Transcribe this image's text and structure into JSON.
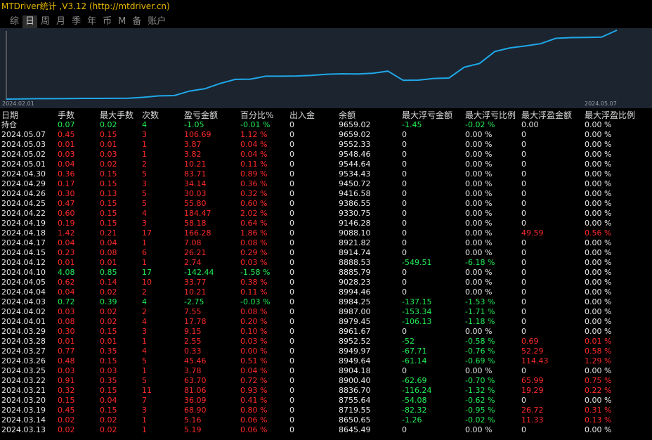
{
  "title": "MTDriver统计 ,V3.12 (http://mtdriver.cn)",
  "tabs": [
    "综",
    "日",
    "周",
    "月",
    "季",
    "年",
    "币",
    "M",
    "备",
    "账户"
  ],
  "active_tab": "日",
  "chart": {
    "start_label": "2024.02.01",
    "end_label": "2024.05.07",
    "line_color": "#1fa8e8",
    "values": [
      8596,
      8598,
      8602,
      8602,
      8604,
      8607,
      8607,
      8608,
      8610,
      8624,
      8645.49,
      8650.65,
      8719.55,
      8755.64,
      8836.7,
      8900.4,
      8904.18,
      8949.64,
      8949.97,
      8952.52,
      8961.67,
      8979.45,
      8987,
      8984.25,
      8994.46,
      9028.23,
      8885.79,
      8888.53,
      8914.74,
      8921.82,
      9088.1,
      9146.28,
      9330.75,
      9386.55,
      9416.58,
      9450.72,
      9534.43,
      9544.64,
      9548.46,
      9552.33,
      9659.02
    ]
  },
  "columns": [
    "日期",
    "手数",
    "最大手数",
    "次数",
    "盈亏金额",
    "百分比%",
    "出入金",
    "余额",
    "最大浮亏金额",
    "最大浮亏比例",
    "最大浮盈金额",
    "最大浮盈比例"
  ],
  "rows": [
    {
      "date": "持仓",
      "lots": "0.07",
      "max_lots": "0.02",
      "count": "4",
      "pnl": "-1.05",
      "pct": "-0.01 %",
      "io": "0",
      "balance": "9659.02",
      "max_loss": "-1.45",
      "max_loss_pct": "-0.02 %",
      "max_gain": "0.00",
      "max_gain_pct": "0.00 %",
      "color": "green",
      "loss_color": "green",
      "gain_color": "white"
    },
    {
      "date": "2024.05.07",
      "lots": "0.45",
      "max_lots": "0.15",
      "count": "3",
      "pnl": "106.69",
      "pct": "1.12 %",
      "io": "0",
      "balance": "9659.02",
      "max_loss": "0",
      "max_loss_pct": "0.00 %",
      "max_gain": "0",
      "max_gain_pct": "0.00 %",
      "color": "red",
      "loss_color": "white",
      "gain_color": "white"
    },
    {
      "date": "2024.05.03",
      "lots": "0.01",
      "max_lots": "0.01",
      "count": "1",
      "pnl": "3.87",
      "pct": "0.04 %",
      "io": "0",
      "balance": "9552.33",
      "max_loss": "0",
      "max_loss_pct": "0.00 %",
      "max_gain": "0",
      "max_gain_pct": "0.00 %",
      "color": "red",
      "loss_color": "white",
      "gain_color": "white"
    },
    {
      "date": "2024.05.02",
      "lots": "0.03",
      "max_lots": "0.03",
      "count": "1",
      "pnl": "3.82",
      "pct": "0.04 %",
      "io": "0",
      "balance": "9548.46",
      "max_loss": "0",
      "max_loss_pct": "0.00 %",
      "max_gain": "0",
      "max_gain_pct": "0.00 %",
      "color": "red",
      "loss_color": "white",
      "gain_color": "white"
    },
    {
      "date": "2024.05.01",
      "lots": "0.04",
      "max_lots": "0.02",
      "count": "2",
      "pnl": "10.21",
      "pct": "0.11 %",
      "io": "0",
      "balance": "9544.64",
      "max_loss": "0",
      "max_loss_pct": "0.00 %",
      "max_gain": "0",
      "max_gain_pct": "0.00 %",
      "color": "red",
      "loss_color": "white",
      "gain_color": "white"
    },
    {
      "date": "2024.04.30",
      "lots": "0.36",
      "max_lots": "0.15",
      "count": "5",
      "pnl": "83.71",
      "pct": "0.89 %",
      "io": "0",
      "balance": "9534.43",
      "max_loss": "0",
      "max_loss_pct": "0.00 %",
      "max_gain": "0",
      "max_gain_pct": "0.00 %",
      "color": "red",
      "loss_color": "white",
      "gain_color": "white"
    },
    {
      "date": "2024.04.29",
      "lots": "0.17",
      "max_lots": "0.15",
      "count": "3",
      "pnl": "34.14",
      "pct": "0.36 %",
      "io": "0",
      "balance": "9450.72",
      "max_loss": "0",
      "max_loss_pct": "0.00 %",
      "max_gain": "0",
      "max_gain_pct": "0.00 %",
      "color": "red",
      "loss_color": "white",
      "gain_color": "white"
    },
    {
      "date": "2024.04.26",
      "lots": "0.30",
      "max_lots": "0.13",
      "count": "5",
      "pnl": "30.03",
      "pct": "0.32 %",
      "io": "0",
      "balance": "9416.58",
      "max_loss": "0",
      "max_loss_pct": "0.00 %",
      "max_gain": "0",
      "max_gain_pct": "0.00 %",
      "color": "red",
      "loss_color": "white",
      "gain_color": "white"
    },
    {
      "date": "2024.04.25",
      "lots": "0.47",
      "max_lots": "0.15",
      "count": "5",
      "pnl": "55.80",
      "pct": "0.60 %",
      "io": "0",
      "balance": "9386.55",
      "max_loss": "0",
      "max_loss_pct": "0.00 %",
      "max_gain": "0",
      "max_gain_pct": "0.00 %",
      "color": "red",
      "loss_color": "white",
      "gain_color": "white"
    },
    {
      "date": "2024.04.22",
      "lots": "0.60",
      "max_lots": "0.15",
      "count": "4",
      "pnl": "184.47",
      "pct": "2.02 %",
      "io": "0",
      "balance": "9330.75",
      "max_loss": "0",
      "max_loss_pct": "0.00 %",
      "max_gain": "0",
      "max_gain_pct": "0.00 %",
      "color": "red",
      "loss_color": "white",
      "gain_color": "white"
    },
    {
      "date": "2024.04.19",
      "lots": "0.19",
      "max_lots": "0.15",
      "count": "3",
      "pnl": "58.18",
      "pct": "0.64 %",
      "io": "0",
      "balance": "9146.28",
      "max_loss": "0",
      "max_loss_pct": "0.00 %",
      "max_gain": "0",
      "max_gain_pct": "0.00 %",
      "color": "red",
      "loss_color": "white",
      "gain_color": "white"
    },
    {
      "date": "2024.04.18",
      "lots": "1.42",
      "max_lots": "0.21",
      "count": "17",
      "pnl": "166.28",
      "pct": "1.86 %",
      "io": "0",
      "balance": "9088.10",
      "max_loss": "0",
      "max_loss_pct": "0.00 %",
      "max_gain": "49.59",
      "max_gain_pct": "0.56 %",
      "color": "red",
      "loss_color": "white",
      "gain_color": "red"
    },
    {
      "date": "2024.04.17",
      "lots": "0.04",
      "max_lots": "0.04",
      "count": "1",
      "pnl": "7.08",
      "pct": "0.08 %",
      "io": "0",
      "balance": "8921.82",
      "max_loss": "0",
      "max_loss_pct": "0.00 %",
      "max_gain": "0",
      "max_gain_pct": "0.00 %",
      "color": "red",
      "loss_color": "white",
      "gain_color": "white"
    },
    {
      "date": "2024.04.15",
      "lots": "0.23",
      "max_lots": "0.08",
      "count": "6",
      "pnl": "26.21",
      "pct": "0.29 %",
      "io": "0",
      "balance": "8914.74",
      "max_loss": "0",
      "max_loss_pct": "0.00 %",
      "max_gain": "0",
      "max_gain_pct": "0.00 %",
      "color": "red",
      "loss_color": "white",
      "gain_color": "white"
    },
    {
      "date": "2024.04.12",
      "lots": "0.01",
      "max_lots": "0.01",
      "count": "1",
      "pnl": "2.74",
      "pct": "0.03 %",
      "io": "0",
      "balance": "8888.53",
      "max_loss": "-549.51",
      "max_loss_pct": "-6.18 %",
      "max_gain": "0",
      "max_gain_pct": "0.00 %",
      "color": "red",
      "loss_color": "green",
      "gain_color": "white"
    },
    {
      "date": "2024.04.10",
      "lots": "4.08",
      "max_lots": "0.85",
      "count": "17",
      "pnl": "-142.44",
      "pct": "-1.58 %",
      "io": "0",
      "balance": "8885.79",
      "max_loss": "0",
      "max_loss_pct": "0.00 %",
      "max_gain": "0",
      "max_gain_pct": "0.00 %",
      "color": "green",
      "loss_color": "white",
      "gain_color": "white"
    },
    {
      "date": "2024.04.05",
      "lots": "0.62",
      "max_lots": "0.14",
      "count": "10",
      "pnl": "33.77",
      "pct": "0.38 %",
      "io": "0",
      "balance": "9028.23",
      "max_loss": "0",
      "max_loss_pct": "0.00 %",
      "max_gain": "0",
      "max_gain_pct": "0.00 %",
      "color": "red",
      "loss_color": "white",
      "gain_color": "white"
    },
    {
      "date": "2024.04.04",
      "lots": "0.04",
      "max_lots": "0.02",
      "count": "2",
      "pnl": "10.21",
      "pct": "0.11 %",
      "io": "0",
      "balance": "8994.46",
      "max_loss": "0",
      "max_loss_pct": "0.00 %",
      "max_gain": "0",
      "max_gain_pct": "0.00 %",
      "color": "red",
      "loss_color": "white",
      "gain_color": "white"
    },
    {
      "date": "2024.04.03",
      "lots": "0.72",
      "max_lots": "0.39",
      "count": "4",
      "pnl": "-2.75",
      "pct": "-0.03 %",
      "io": "0",
      "balance": "8984.25",
      "max_loss": "-137.15",
      "max_loss_pct": "-1.53 %",
      "max_gain": "0",
      "max_gain_pct": "0.00 %",
      "color": "green",
      "loss_color": "green",
      "gain_color": "white"
    },
    {
      "date": "2024.04.02",
      "lots": "0.03",
      "max_lots": "0.02",
      "count": "2",
      "pnl": "7.55",
      "pct": "0.08 %",
      "io": "0",
      "balance": "8987.00",
      "max_loss": "-153.34",
      "max_loss_pct": "-1.71 %",
      "max_gain": "0",
      "max_gain_pct": "0.00 %",
      "color": "red",
      "loss_color": "green",
      "gain_color": "white"
    },
    {
      "date": "2024.04.01",
      "lots": "0.08",
      "max_lots": "0.02",
      "count": "4",
      "pnl": "17.78",
      "pct": "0.20 %",
      "io": "0",
      "balance": "8979.45",
      "max_loss": "-106.13",
      "max_loss_pct": "-1.18 %",
      "max_gain": "0",
      "max_gain_pct": "0.00 %",
      "color": "red",
      "loss_color": "green",
      "gain_color": "white"
    },
    {
      "date": "2024.03.29",
      "lots": "0.30",
      "max_lots": "0.15",
      "count": "3",
      "pnl": "9.15",
      "pct": "0.10 %",
      "io": "0",
      "balance": "8961.67",
      "max_loss": "0",
      "max_loss_pct": "0.00 %",
      "max_gain": "0",
      "max_gain_pct": "0.00 %",
      "color": "red",
      "loss_color": "white",
      "gain_color": "white"
    },
    {
      "date": "2024.03.28",
      "lots": "0.01",
      "max_lots": "0.01",
      "count": "1",
      "pnl": "2.55",
      "pct": "0.03 %",
      "io": "0",
      "balance": "8952.52",
      "max_loss": "-52",
      "max_loss_pct": "-0.58 %",
      "max_gain": "0.69",
      "max_gain_pct": "0.01 %",
      "color": "red",
      "loss_color": "green",
      "gain_color": "red"
    },
    {
      "date": "2024.03.27",
      "lots": "0.77",
      "max_lots": "0.35",
      "count": "4",
      "pnl": "0.33",
      "pct": "0.00 %",
      "io": "0",
      "balance": "8949.97",
      "max_loss": "-67.71",
      "max_loss_pct": "-0.76 %",
      "max_gain": "52.29",
      "max_gain_pct": "0.58 %",
      "color": "red",
      "loss_color": "green",
      "gain_color": "red"
    },
    {
      "date": "2024.03.26",
      "lots": "0.48",
      "max_lots": "0.15",
      "count": "5",
      "pnl": "45.46",
      "pct": "0.51 %",
      "io": "0",
      "balance": "8949.64",
      "max_loss": "-61.14",
      "max_loss_pct": "-0.69 %",
      "max_gain": "114.43",
      "max_gain_pct": "1.29 %",
      "color": "red",
      "loss_color": "green",
      "gain_color": "red"
    },
    {
      "date": "2024.03.25",
      "lots": "0.03",
      "max_lots": "0.03",
      "count": "1",
      "pnl": "3.78",
      "pct": "0.04 %",
      "io": "0",
      "balance": "8904.18",
      "max_loss": "0",
      "max_loss_pct": "0.00 %",
      "max_gain": "0",
      "max_gain_pct": "0.00 %",
      "color": "red",
      "loss_color": "white",
      "gain_color": "white"
    },
    {
      "date": "2024.03.22",
      "lots": "0.91",
      "max_lots": "0.35",
      "count": "5",
      "pnl": "63.70",
      "pct": "0.72 %",
      "io": "0",
      "balance": "8900.40",
      "max_loss": "-62.69",
      "max_loss_pct": "-0.70 %",
      "max_gain": "65.99",
      "max_gain_pct": "0.75 %",
      "color": "red",
      "loss_color": "green",
      "gain_color": "red"
    },
    {
      "date": "2024.03.21",
      "lots": "0.32",
      "max_lots": "0.15",
      "count": "11",
      "pnl": "81.06",
      "pct": "0.93 %",
      "io": "0",
      "balance": "8836.70",
      "max_loss": "-116.24",
      "max_loss_pct": "-1.32 %",
      "max_gain": "19.29",
      "max_gain_pct": "0.22 %",
      "color": "red",
      "loss_color": "green",
      "gain_color": "red"
    },
    {
      "date": "2024.03.20",
      "lots": "0.15",
      "max_lots": "0.04",
      "count": "7",
      "pnl": "36.09",
      "pct": "0.41 %",
      "io": "0",
      "balance": "8755.64",
      "max_loss": "-54.08",
      "max_loss_pct": "-0.62 %",
      "max_gain": "0",
      "max_gain_pct": "0.00 %",
      "color": "red",
      "loss_color": "green",
      "gain_color": "white"
    },
    {
      "date": "2024.03.19",
      "lots": "0.45",
      "max_lots": "0.15",
      "count": "3",
      "pnl": "68.90",
      "pct": "0.80 %",
      "io": "0",
      "balance": "8719.55",
      "max_loss": "-82.32",
      "max_loss_pct": "-0.95 %",
      "max_gain": "26.72",
      "max_gain_pct": "0.31 %",
      "color": "red",
      "loss_color": "green",
      "gain_color": "red"
    },
    {
      "date": "2024.03.14",
      "lots": "0.02",
      "max_lots": "0.02",
      "count": "1",
      "pnl": "5.16",
      "pct": "0.06 %",
      "io": "0",
      "balance": "8650.65",
      "max_loss": "-1.26",
      "max_loss_pct": "-0.02 %",
      "max_gain": "11.33",
      "max_gain_pct": "0.13 %",
      "color": "red",
      "loss_color": "green",
      "gain_color": "red"
    },
    {
      "date": "2024.03.13",
      "lots": "0.02",
      "max_lots": "0.02",
      "count": "1",
      "pnl": "5.19",
      "pct": "0.06 %",
      "io": "0",
      "balance": "8645.49",
      "max_loss": "0",
      "max_loss_pct": "0.00 %",
      "max_gain": "0",
      "max_gain_pct": "0.00 %",
      "color": "red",
      "loss_color": "white",
      "gain_color": "white"
    }
  ]
}
